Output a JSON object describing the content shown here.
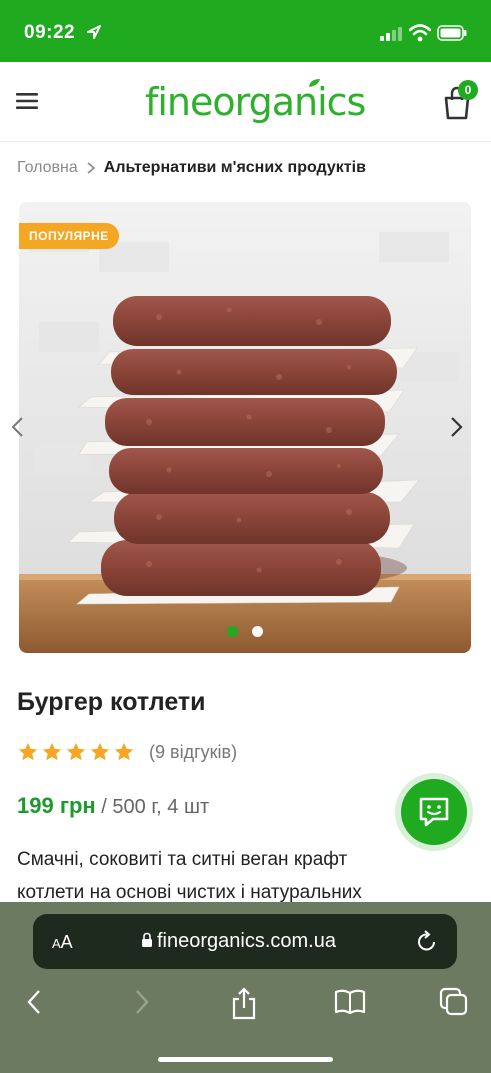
{
  "status_bar": {
    "time": "09:22"
  },
  "header": {
    "logo_part1": "fine",
    "logo_part2": "organics",
    "cart_count": "0"
  },
  "breadcrumb": {
    "home": "Головна",
    "current": "Альтернативи м'ясних продуктів"
  },
  "gallery": {
    "badge": "ПОПУЛЯРНЕ",
    "slide_count": 2,
    "active_slide": 1
  },
  "product": {
    "title": "Бургер котлети",
    "rating_stars": 5,
    "reviews": "(9 відгуків)",
    "price": "199 грн",
    "unit": " / 500 г, 4 шт",
    "description": "Смачні, соковиті та ситні веган крафт котлети на основі чистих і натуральних"
  },
  "browser": {
    "text_size_label_small": "A",
    "text_size_label_large": "A",
    "url": "fineorganics.com.ua"
  },
  "colors": {
    "brand_green": "#1faa1f",
    "badge_orange": "#f5a623",
    "price_green": "#1d9a2e",
    "star": "#f5a623"
  }
}
